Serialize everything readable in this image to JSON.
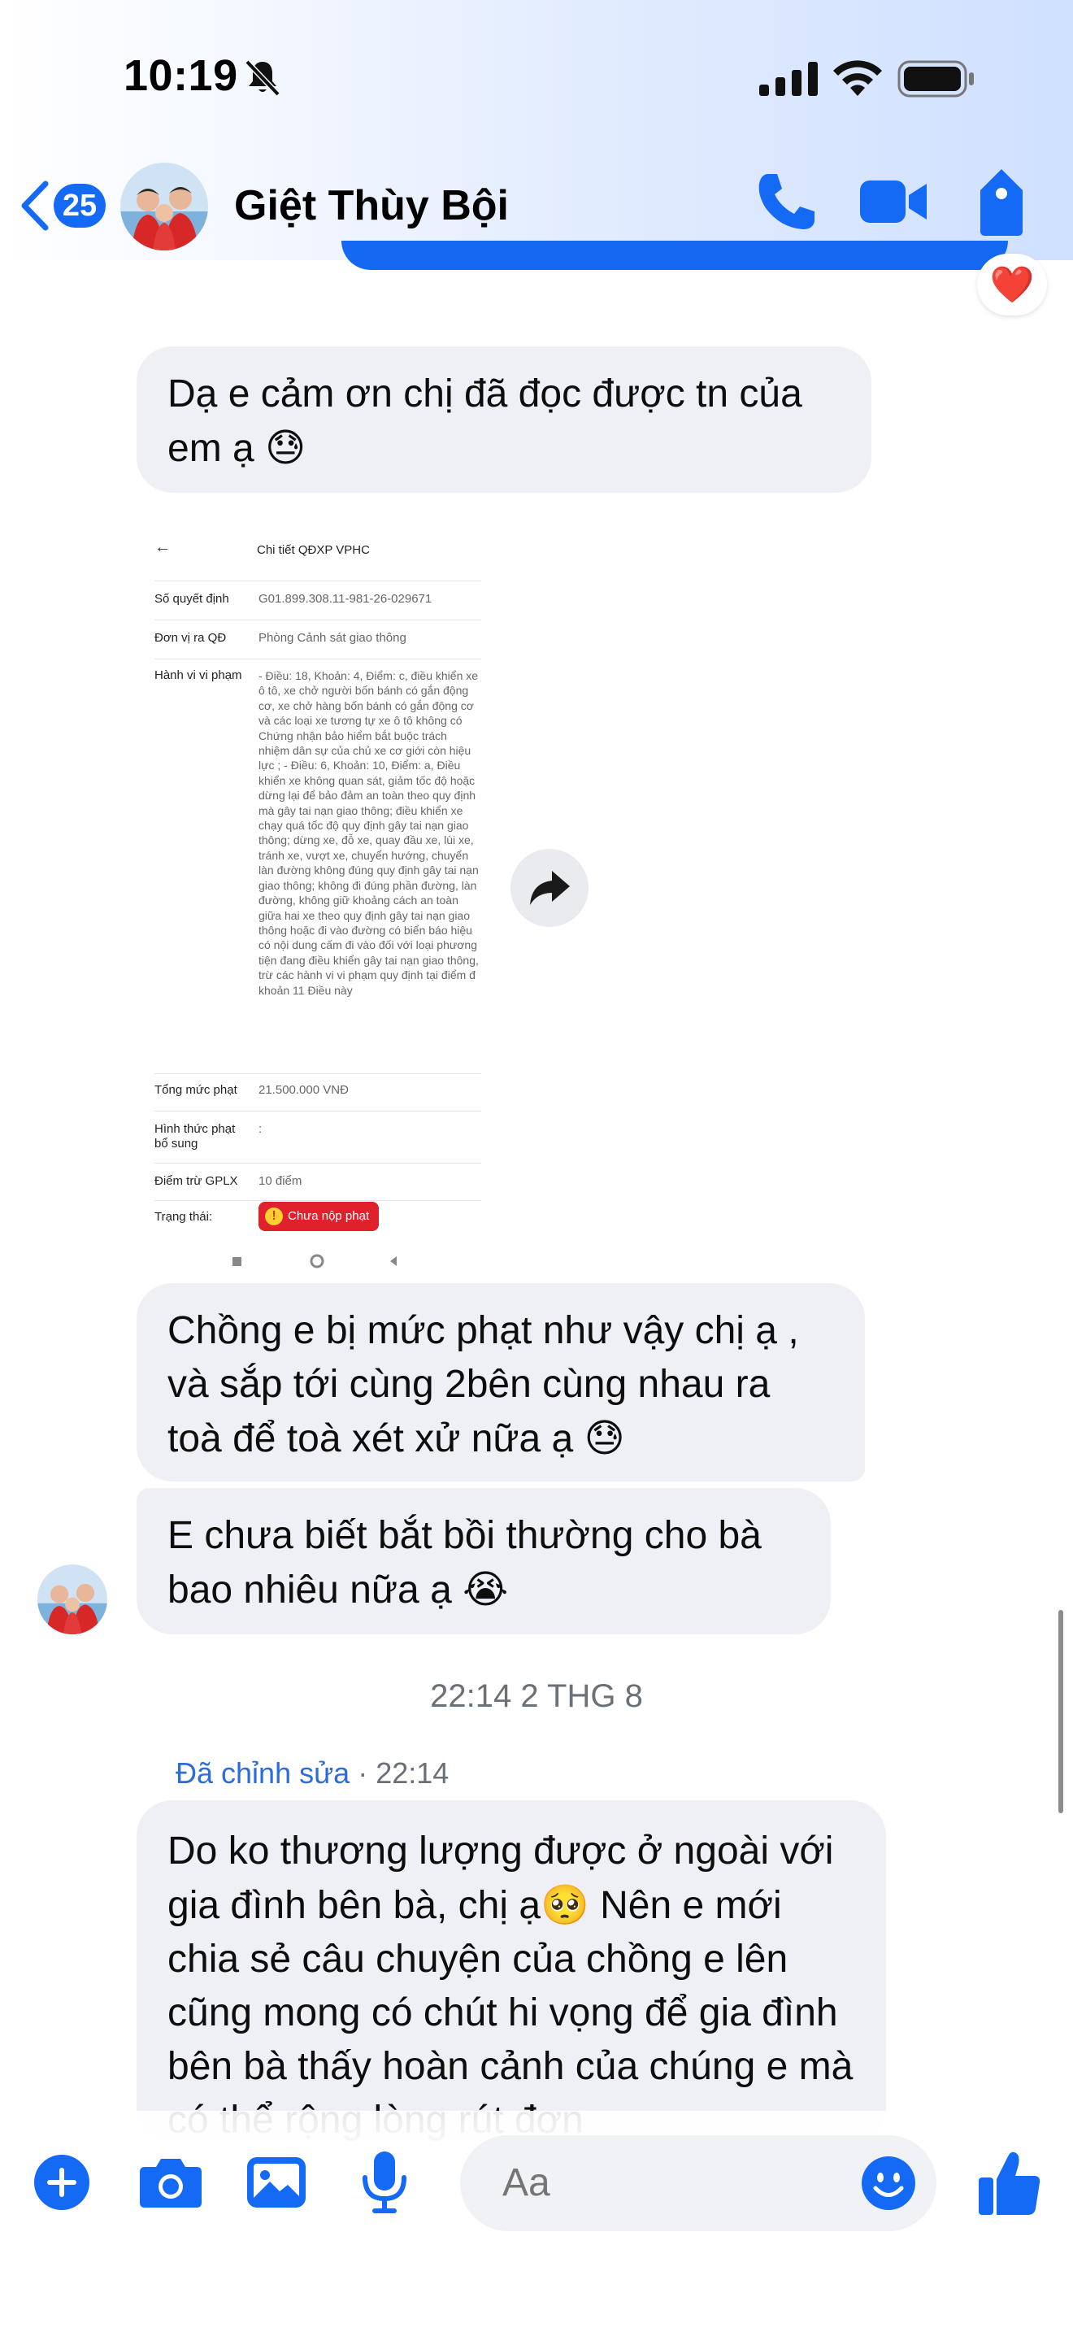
{
  "status_bar": {
    "time": "10:19"
  },
  "header": {
    "back_badge_count": "25",
    "contact_name": "Giệt Thùy Bội",
    "accent_color": "#1469f5"
  },
  "messages": {
    "msg1": {
      "text": "Dạ e cảm ơn chị đã đọc được tn của em ạ",
      "emoji": "😓"
    },
    "image_message": {
      "back_arrow": "←",
      "title": "Chi tiết QĐXP VPHC",
      "fields": [
        {
          "label": "Số quyết định",
          "value": "G01.899.308.11-981-26-029671"
        },
        {
          "label": "Đơn vị ra QĐ",
          "value": "Phòng Cảnh sát giao thông"
        },
        {
          "label": "Hành vi vi phạm",
          "value": "- Điều: 18, Khoản: 4, Điểm: c, điều khiển xe ô tô, xe chở người bốn bánh có gắn động cơ, xe chở hàng bốn bánh có gắn động cơ và các loại xe tương tự xe ô tô không có Chứng nhận bảo hiểm bắt buộc trách nhiệm dân sự của chủ xe cơ giới còn hiệu lực ; - Điều: 6, Khoản: 10, Điểm: a, Điều khiển xe không quan sát, giảm tốc độ hoặc dừng lại để bảo đảm an toàn theo quy định mà gây tai nạn giao thông; điều khiển xe chạy quá tốc độ quy định gây tai nạn giao thông; dừng xe, đỗ xe, quay đầu xe, lùi xe, tránh xe, vượt xe, chuyển hướng, chuyển làn đường không đúng quy định gây tai nạn giao thông; không đi đúng phần đường, làn đường, không giữ khoảng cách an toàn giữa hai xe theo quy định gây tai nạn giao thông hoặc đi vào đường có biển báo hiệu có nội dung cấm đi vào đối với loại phương tiện đang điều khiển gây tai nạn giao thông, trừ các hành vi vi phạm quy định tại điểm đ khoản 11 Điều này"
        },
        {
          "label": "Tổng mức phạt",
          "value": "21.500.000 VNĐ"
        },
        {
          "label": "Hình thức phạt bổ sung",
          "value": ":"
        },
        {
          "label": "Điểm trừ GPLX",
          "value": "10 điểm"
        },
        {
          "label": "Trạng thái:",
          "value": ""
        }
      ],
      "status_pill": "Chưa nộp phạt",
      "status_pill_icon": "!"
    },
    "msg2": {
      "text": "Chồng e bị mức phạt như vậy chị ạ , và sắp tới cùng 2bên cùng nhau ra toà để toà xét xử nữa ạ",
      "emoji": "😓"
    },
    "msg3": {
      "text": "E chưa biết bắt bồi thường cho bà bao nhiêu nữa ạ",
      "emoji": "😭"
    },
    "timestamp": "22:14 2 THG 8",
    "edited": {
      "label": "Đã chỉnh sửa",
      "separator": " · ",
      "time": "22:14"
    },
    "msg4": {
      "text_before_emoji": "Do ko thương lượng được ở ngoài với gia đình bên bà, chị ạ",
      "emoji": "🥺",
      "text_after_emoji": " Nên e mới chia sẻ câu chuyện của chồng e lên cũng mong có chút hi vọng để gia đình bên bà thấy hoàn cảnh của chúng e mà có thể rộng lòng rút đơn"
    },
    "reaction": "❤️"
  },
  "composer": {
    "placeholder": "Aa",
    "icons": [
      "plus-icon",
      "camera-icon",
      "gallery-icon",
      "microphone-icon",
      "emoji-icon",
      "thumbs-up-icon"
    ]
  }
}
